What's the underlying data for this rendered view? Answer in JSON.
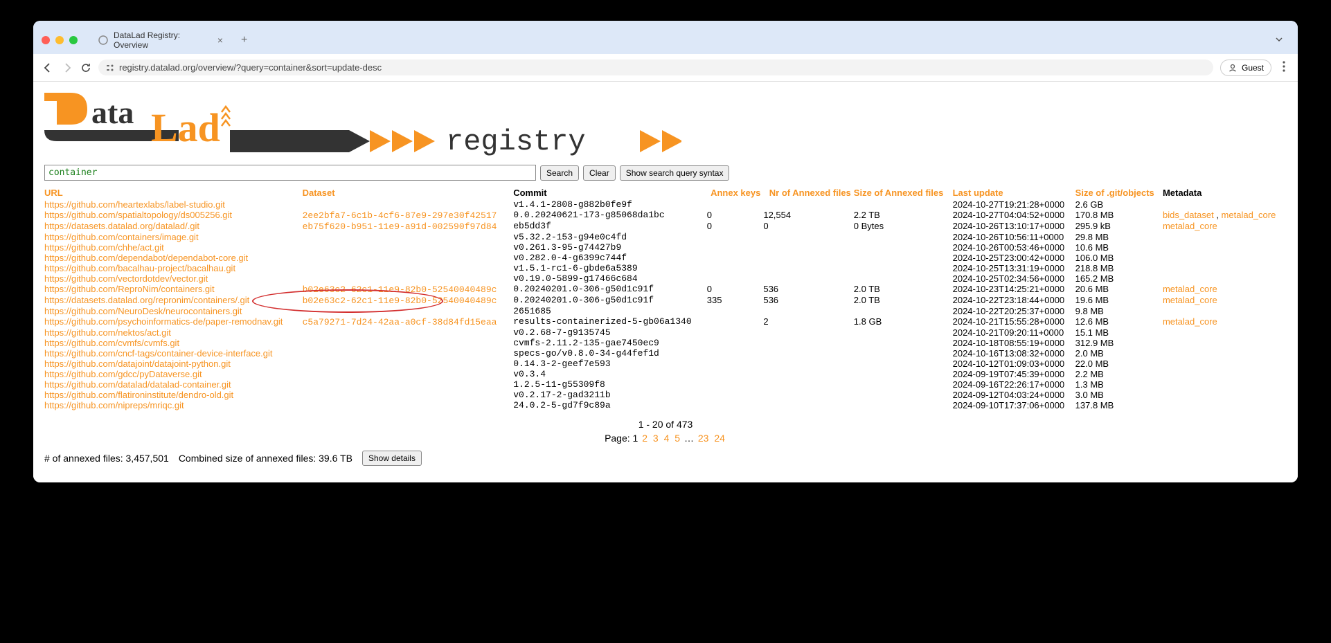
{
  "browser": {
    "tab_title": "DataLad Registry: Overview",
    "address": "registry.datalad.org/overview/?query=container&sort=update-desc",
    "guest_label": "Guest"
  },
  "logo": {
    "registry_text": "registry"
  },
  "search": {
    "value": "container",
    "search_btn": "Search",
    "clear_btn": "Clear",
    "syntax_btn": "Show search query syntax"
  },
  "headers": {
    "url": "URL",
    "dataset": "Dataset",
    "commit": "Commit",
    "annex_keys": "Annex keys",
    "annexed_files": "Nr of Annexed files",
    "annexed_size": "Size of Annexed files",
    "last_update": "Last update",
    "git_objects": "Size of .git/objects",
    "metadata": "Metadata"
  },
  "rows": [
    {
      "url": "https://github.com/heartexlabs/label-studio.git",
      "dataset": "",
      "commit": "v1.4.1-2808-g882b0fe9f",
      "ak": "",
      "nf": "",
      "sz": "",
      "lu": "2024-10-27T19:21:28+0000",
      "go": "2.6 GB",
      "md": []
    },
    {
      "url": "https://github.com/spatialtopology/ds005256.git",
      "dataset": "2ee2bfa7-6c1b-4cf6-87e9-297e30f42517",
      "commit": "0.0.20240621-173-g85068da1bc",
      "ak": "0",
      "nf": "12,554",
      "sz": "2.2 TB",
      "lu": "2024-10-27T04:04:52+0000",
      "go": "170.8 MB",
      "md": [
        "bids_dataset",
        "metalad_core"
      ]
    },
    {
      "url": "https://datasets.datalad.org/datalad/.git",
      "dataset": "eb75f620-b951-11e9-a91d-002590f97d84",
      "commit": "eb5dd3f",
      "ak": "0",
      "nf": "0",
      "sz": "0 Bytes",
      "lu": "2024-10-26T13:10:17+0000",
      "go": "295.9 kB",
      "md": [
        "metalad_core"
      ]
    },
    {
      "url": "https://github.com/containers/image.git",
      "dataset": "",
      "commit": "v5.32.2-153-g94e0c4fd",
      "ak": "",
      "nf": "",
      "sz": "",
      "lu": "2024-10-26T10:56:11+0000",
      "go": "29.8 MB",
      "md": []
    },
    {
      "url": "https://github.com/chhe/act.git",
      "dataset": "",
      "commit": "v0.261.3-95-g74427b9",
      "ak": "",
      "nf": "",
      "sz": "",
      "lu": "2024-10-26T00:53:46+0000",
      "go": "10.6 MB",
      "md": []
    },
    {
      "url": "https://github.com/dependabot/dependabot-core.git",
      "dataset": "",
      "commit": "v0.282.0-4-g6399c744f",
      "ak": "",
      "nf": "",
      "sz": "",
      "lu": "2024-10-25T23:00:42+0000",
      "go": "106.0 MB",
      "md": []
    },
    {
      "url": "https://github.com/bacalhau-project/bacalhau.git",
      "dataset": "",
      "commit": "v1.5.1-rc1-6-gbde6a5389",
      "ak": "",
      "nf": "",
      "sz": "",
      "lu": "2024-10-25T13:31:19+0000",
      "go": "218.8 MB",
      "md": []
    },
    {
      "url": "https://github.com/vectordotdev/vector.git",
      "dataset": "",
      "commit": "v0.19.0-5899-g17466c684",
      "ak": "",
      "nf": "",
      "sz": "",
      "lu": "2024-10-25T02:34:56+0000",
      "go": "165.2 MB",
      "md": []
    },
    {
      "url": "https://github.com/ReproNim/containers.git",
      "dataset": "b02e63c2-62c1-11e9-82b0-52540040489c",
      "commit": "0.20240201.0-306-g50d1c91f",
      "ak": "0",
      "nf": "536",
      "sz": "2.0 TB",
      "lu": "2024-10-23T14:25:21+0000",
      "go": "20.6 MB",
      "md": [
        "metalad_core"
      ]
    },
    {
      "url": "https://datasets.datalad.org/repronim/containers/.git",
      "dataset": "b02e63c2-62c1-11e9-82b0-52540040489c",
      "commit": "0.20240201.0-306-g50d1c91f",
      "ak": "335",
      "nf": "536",
      "sz": "2.0 TB",
      "lu": "2024-10-22T23:18:44+0000",
      "go": "19.6 MB",
      "md": [
        "metalad_core"
      ]
    },
    {
      "url": "https://github.com/NeuroDesk/neurocontainers.git",
      "dataset": "",
      "commit": "2651685",
      "ak": "",
      "nf": "",
      "sz": "",
      "lu": "2024-10-22T20:25:37+0000",
      "go": "9.8 MB",
      "md": []
    },
    {
      "url": "https://github.com/psychoinformatics-de/paper-remodnav.git",
      "dataset": "c5a79271-7d24-42aa-a0cf-38d84fd15eaa",
      "commit": "results-containerized-5-gb06a1340",
      "ak": "",
      "nf": "2",
      "sz": "1.8 GB",
      "lu": "2024-10-21T15:55:28+0000",
      "go": "12.6 MB",
      "md": [
        "metalad_core"
      ]
    },
    {
      "url": "https://github.com/nektos/act.git",
      "dataset": "",
      "commit": "v0.2.68-7-g9135745",
      "ak": "",
      "nf": "",
      "sz": "",
      "lu": "2024-10-21T09:20:11+0000",
      "go": "15.1 MB",
      "md": []
    },
    {
      "url": "https://github.com/cvmfs/cvmfs.git",
      "dataset": "",
      "commit": "cvmfs-2.11.2-135-gae7450ec9",
      "ak": "",
      "nf": "",
      "sz": "",
      "lu": "2024-10-18T08:55:19+0000",
      "go": "312.9 MB",
      "md": []
    },
    {
      "url": "https://github.com/cncf-tags/container-device-interface.git",
      "dataset": "",
      "commit": "specs-go/v0.8.0-34-g44fef1d",
      "ak": "",
      "nf": "",
      "sz": "",
      "lu": "2024-10-16T13:08:32+0000",
      "go": "2.0 MB",
      "md": []
    },
    {
      "url": "https://github.com/datajoint/datajoint-python.git",
      "dataset": "",
      "commit": "0.14.3-2-geef7e593",
      "ak": "",
      "nf": "",
      "sz": "",
      "lu": "2024-10-12T01:09:03+0000",
      "go": "22.0 MB",
      "md": []
    },
    {
      "url": "https://github.com/gdcc/pyDataverse.git",
      "dataset": "",
      "commit": "v0.3.4",
      "ak": "",
      "nf": "",
      "sz": "",
      "lu": "2024-09-19T07:45:39+0000",
      "go": "2.2 MB",
      "md": []
    },
    {
      "url": "https://github.com/datalad/datalad-container.git",
      "dataset": "",
      "commit": "1.2.5-11-g55309f8",
      "ak": "",
      "nf": "",
      "sz": "",
      "lu": "2024-09-16T22:26:17+0000",
      "go": "1.3 MB",
      "md": []
    },
    {
      "url": "https://github.com/flatironinstitute/dendro-old.git",
      "dataset": "",
      "commit": "v0.2.17-2-gad3211b",
      "ak": "",
      "nf": "",
      "sz": "",
      "lu": "2024-09-12T04:03:24+0000",
      "go": "3.0 MB",
      "md": []
    },
    {
      "url": "https://github.com/nipreps/mriqc.git",
      "dataset": "",
      "commit": "24.0.2-5-gd7f9c89a",
      "ak": "",
      "nf": "",
      "sz": "",
      "lu": "2024-09-10T17:37:06+0000",
      "go": "137.8 MB",
      "md": []
    }
  ],
  "pagination": {
    "summary": "1 - 20 of 473",
    "label": "Page:",
    "current": "1",
    "pages": [
      "2",
      "3",
      "4",
      "5"
    ],
    "ellipsis": "…",
    "last_pages": [
      "23",
      "24"
    ]
  },
  "footer": {
    "annexed_files": "# of annexed files: 3,457,501",
    "combined_size": "Combined size of annexed files: 39.6 TB",
    "show_details": "Show details"
  }
}
